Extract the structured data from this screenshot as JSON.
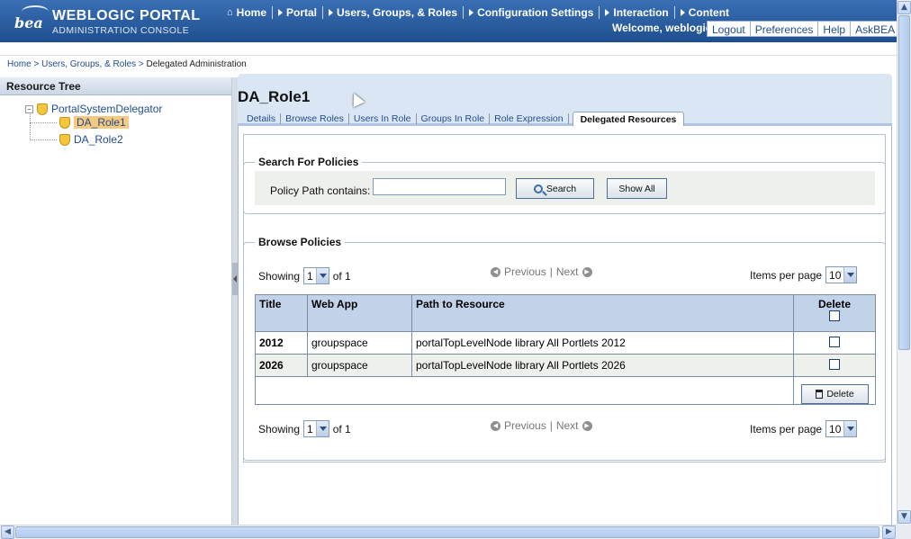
{
  "header": {
    "logo_mark": "bea",
    "title": "WEBLOGIC PORTAL",
    "subtitle": "ADMINISTRATION CONSOLE",
    "nav": [
      "Home",
      "Portal",
      "Users, Groups, & Roles",
      "Configuration Settings",
      "Interaction",
      "Content"
    ],
    "welcome": "Welcome, weblogic",
    "user_links": [
      "Logout",
      "Preferences",
      "Help",
      "AskBEA"
    ]
  },
  "breadcrumb": {
    "items": [
      "Home",
      "Users, Groups, & Roles",
      "Delegated Administration"
    ],
    "separator": ">"
  },
  "tree": {
    "title": "Resource Tree",
    "root": "PortalSystemDelegator",
    "toggle": "−",
    "children": [
      "DA_Role1",
      "DA_Role2"
    ]
  },
  "page": {
    "title": "DA_Role1",
    "tabs": [
      "Details",
      "Browse Roles",
      "Users In Role",
      "Groups In Role",
      "Role Expression",
      "Delegated Resources"
    ],
    "active_tab": "Delegated Resources"
  },
  "search": {
    "legend": "Search For Policies",
    "label": "Policy Path contains:",
    "value": "",
    "search_button": "Search",
    "show_all_button": "Show All"
  },
  "browse": {
    "legend": "Browse Policies",
    "showing_label": "Showing",
    "page_value": "1",
    "of_label": "of 1",
    "previous": "Previous",
    "next": "Next",
    "items_per_page_label": "Items per page",
    "items_per_page_value": "10",
    "columns": [
      "Title",
      "Web App",
      "Path to Resource",
      "Delete"
    ],
    "rows": [
      {
        "title": "2012",
        "web_app": "groupspace",
        "path": "portalTopLevelNode library All Portlets 2012"
      },
      {
        "title": "2026",
        "web_app": "groupspace",
        "path": "portalTopLevelNode library All Portlets 2026"
      }
    ],
    "delete_button": "Delete"
  },
  "colors": {
    "header_bg": "#1e4f8f",
    "link": "#1f4c8f",
    "table_header": "#c2d3e9",
    "tree_selected": "#f6c97f"
  }
}
